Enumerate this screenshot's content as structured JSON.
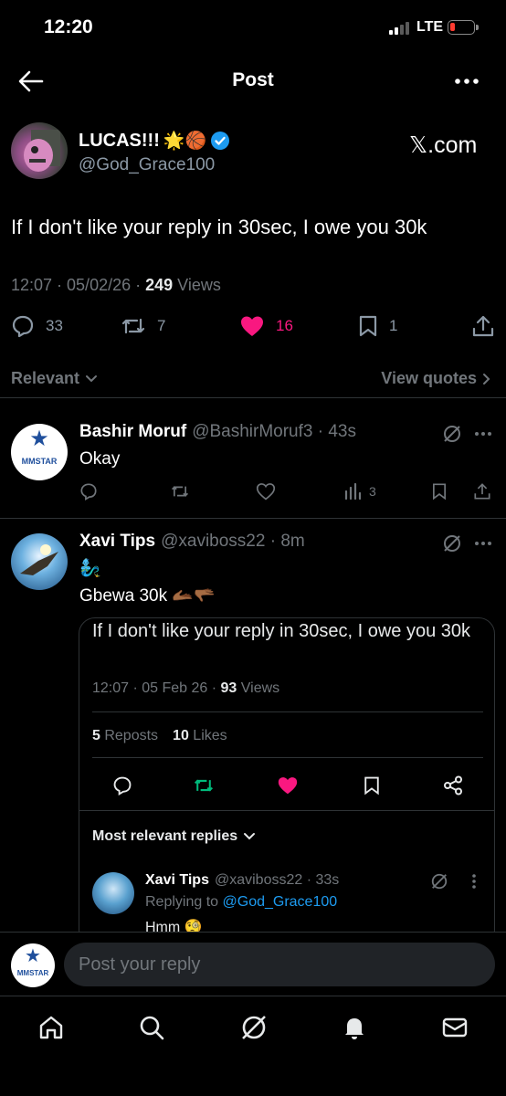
{
  "status_bar": {
    "time": "12:20",
    "network": "LTE"
  },
  "header": {
    "title": "Post"
  },
  "main_post": {
    "author_name": "LUCAS!!!",
    "author_emoji": "🌟🏀",
    "handle": "@God_Grace100",
    "watermark": "𝕏.com",
    "text": "If I don't like your reply in 30sec, I owe you 30k",
    "time": "12:07 · 05/02/26 · ",
    "views_count": "249",
    "views_label": " Views",
    "replies": "33",
    "reposts": "7",
    "likes": "16",
    "bookmarks": "1"
  },
  "sort": {
    "left_label": "Relevant",
    "right_label": "View quotes"
  },
  "replies": [
    {
      "name": "Bashir Moruf",
      "handle": "@BashirMoruf3 · 43s",
      "text": "Okay",
      "views": "3",
      "avatar_text": "MMSTAR"
    },
    {
      "name": "Xavi Tips",
      "handle": "@xaviboss22 · 8m",
      "emoji_line": "🧞‍♂️",
      "text": "Gbewa 30k 🫴🏾🫳🏾",
      "quote": {
        "text": "If I don't like your reply in 30sec, I owe you 30k",
        "meta": "12:07 · 05 Feb 26 · ",
        "views_count": "93",
        "views_label": " Views",
        "reposts_count": "5",
        "reposts_label": " Reposts",
        "likes_count": "10",
        "likes_label": " Likes",
        "most_relevant": "Most relevant replies",
        "sub_reply": {
          "name": "Xavi Tips",
          "handle": "@xaviboss22 · 33s",
          "replying_to_label": "Replying to ",
          "replying_to": "@God_Grace100",
          "text": "Hmm 🧐"
        }
      }
    }
  ],
  "composer": {
    "placeholder": "Post your reply",
    "avatar_text": "MMSTAR"
  },
  "colors": {
    "accent": "#1d9bf0",
    "like": "#f91880",
    "repost": "#00ba7c",
    "muted": "#71767b"
  }
}
